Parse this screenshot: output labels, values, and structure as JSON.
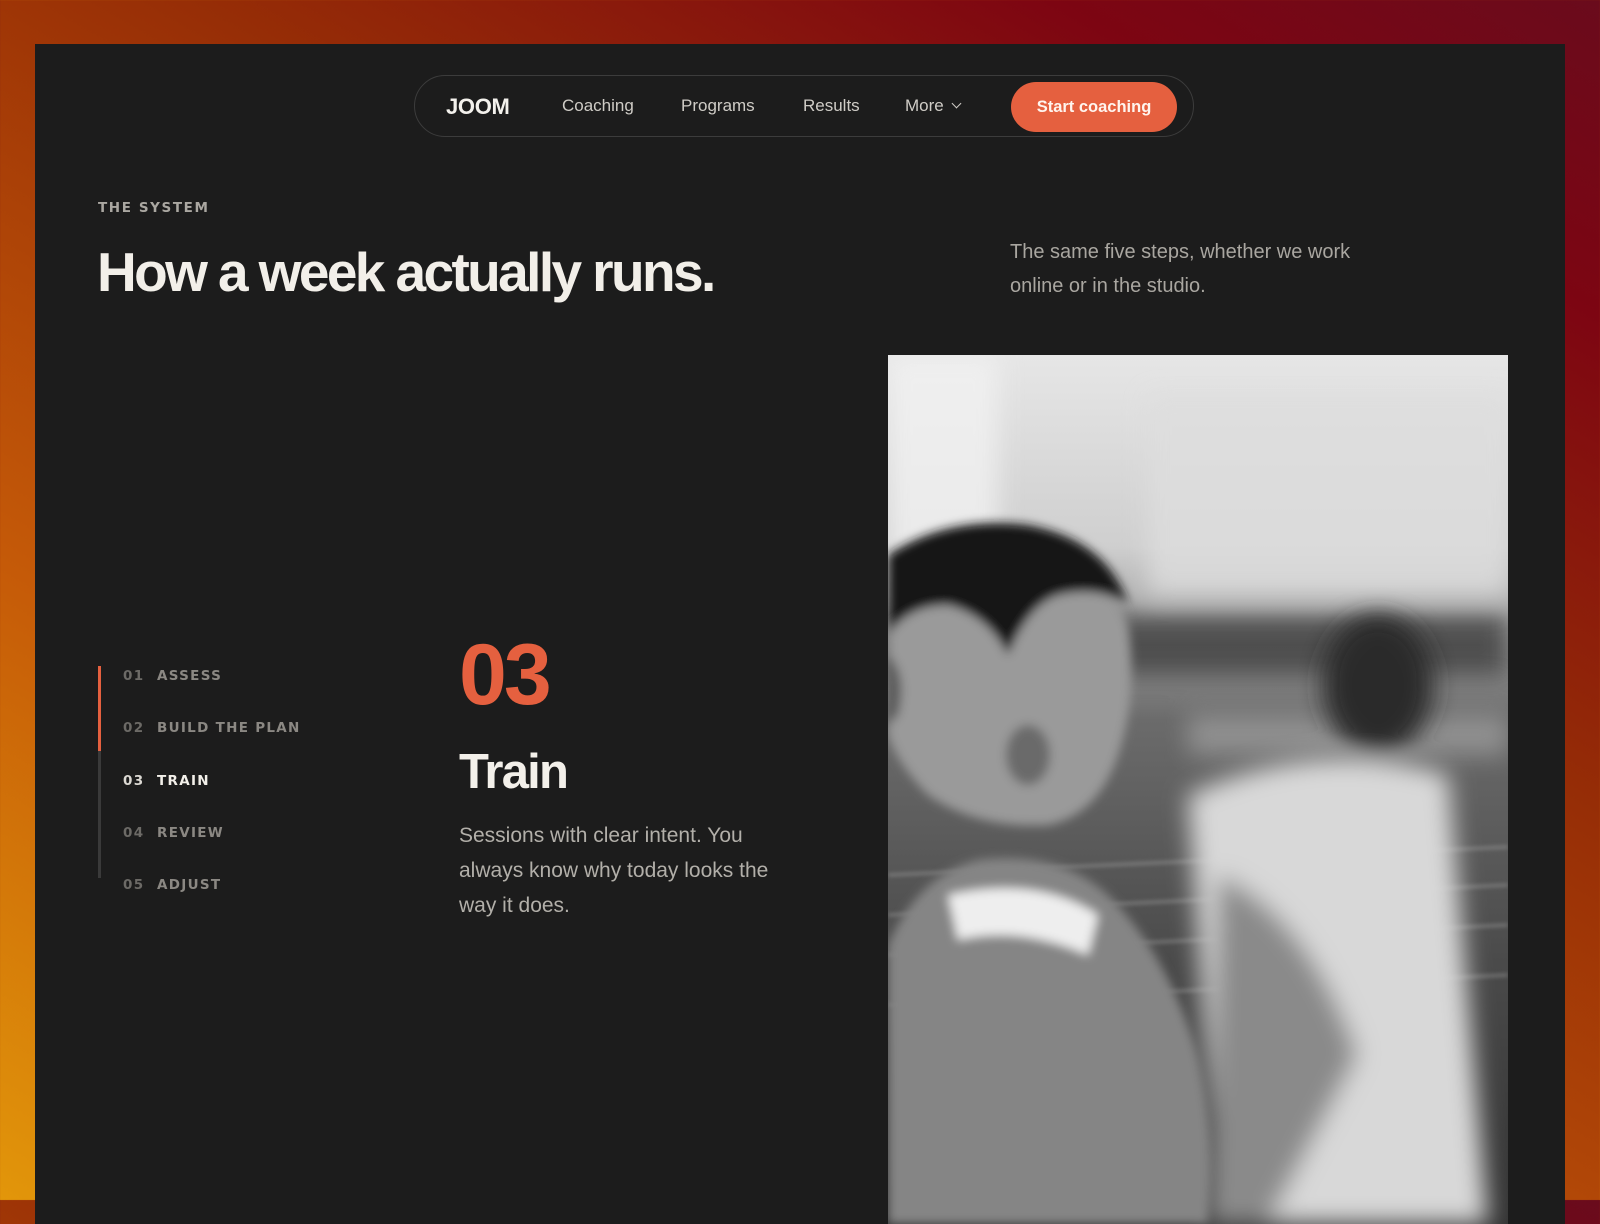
{
  "nav": {
    "brand": "JOOM",
    "links": [
      "Coaching",
      "Programs",
      "Results",
      "More"
    ],
    "cta_label": "Start coaching"
  },
  "hero": {
    "eyebrow": "THE SYSTEM",
    "headline": "How a week actually runs.",
    "intro": "The same five steps, whether we work online or in the studio."
  },
  "steps": {
    "progress_fraction": 0.4,
    "items": [
      {
        "num": "01",
        "label": "ASSESS"
      },
      {
        "num": "02",
        "label": "BUILD THE PLAN"
      },
      {
        "num": "03",
        "label": "TRAIN"
      },
      {
        "num": "04",
        "label": "REVIEW"
      },
      {
        "num": "05",
        "label": "ADJUST"
      }
    ],
    "active_index": 2
  },
  "active_step": {
    "number": "03",
    "title": "Train",
    "description": "Sessions with clear intent. You always know why today looks the way it does."
  },
  "colors": {
    "accent": "#e5603f",
    "page_bg": "#1c1c1c",
    "headline": "#f2efe9"
  },
  "icons": {
    "more_menu": "chevron-down-icon"
  }
}
